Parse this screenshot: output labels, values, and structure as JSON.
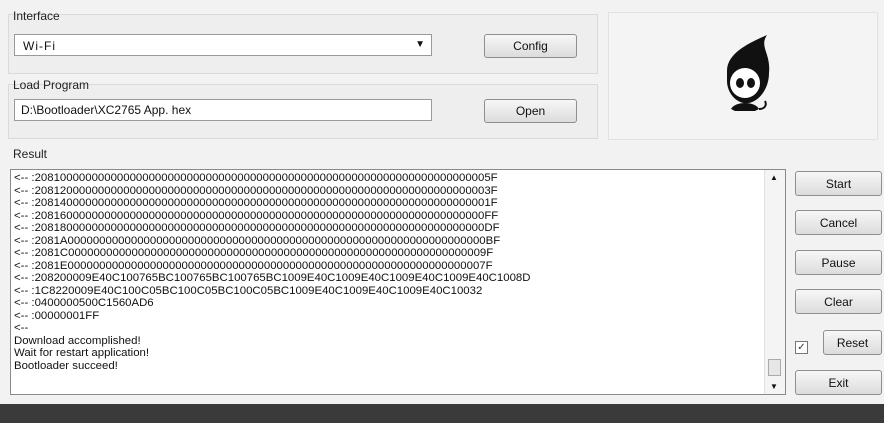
{
  "interface": {
    "label": "Interface",
    "selected": "Wi-Fi",
    "config_label": "Config"
  },
  "load_program": {
    "label": "Load Program",
    "path": "D:\\Bootloader\\XC2765 App. hex",
    "open_label": "Open"
  },
  "result": {
    "label": "Result",
    "lines": [
      "<-- :208100000000000000000000000000000000000000000000000000000000000000000005F",
      "<-- :208120000000000000000000000000000000000000000000000000000000000000000003F",
      "<-- :208140000000000000000000000000000000000000000000000000000000000000000001F",
      "<-- :20816000000000000000000000000000000000000000000000000000000000000000000FF",
      "<-- :20818000000000000000000000000000000000000000000000000000000000000000000DF",
      "<-- :2081A000000000000000000000000000000000000000000000000000000000000000000BF",
      "<-- :2081C000000000000000000000000000000000000000000000000000000000000000009F",
      "<-- :2081E000000000000000000000000000000000000000000000000000000000000000007F",
      "<-- :208200009E40C100765BC100765BC100765BC1009E40C1009E40C1009E40C1009E40C1008D",
      "<-- :1C8220009E40C100C05BC100C05BC100C05BC1009E40C1009E40C1009E40C10032",
      "<-- :0400000500C1560AD6",
      "<-- :00000001FF",
      "<--",
      "Download accomplished!",
      "Wait for restart application!",
      "Bootloader succeed!"
    ]
  },
  "buttons": {
    "start": "Start",
    "cancel": "Cancel",
    "pause": "Pause",
    "clear": "Clear",
    "reset": "Reset",
    "exit": "Exit"
  },
  "reset_checkbox_checked": true,
  "icons": {
    "logo": "hooded-ghost-mascot-logo",
    "dropdown": "chevron-down-icon",
    "scroll_up": "scroll-up-arrow-icon",
    "scroll_down": "scroll-down-arrow-icon",
    "check": "checkmark-icon"
  }
}
